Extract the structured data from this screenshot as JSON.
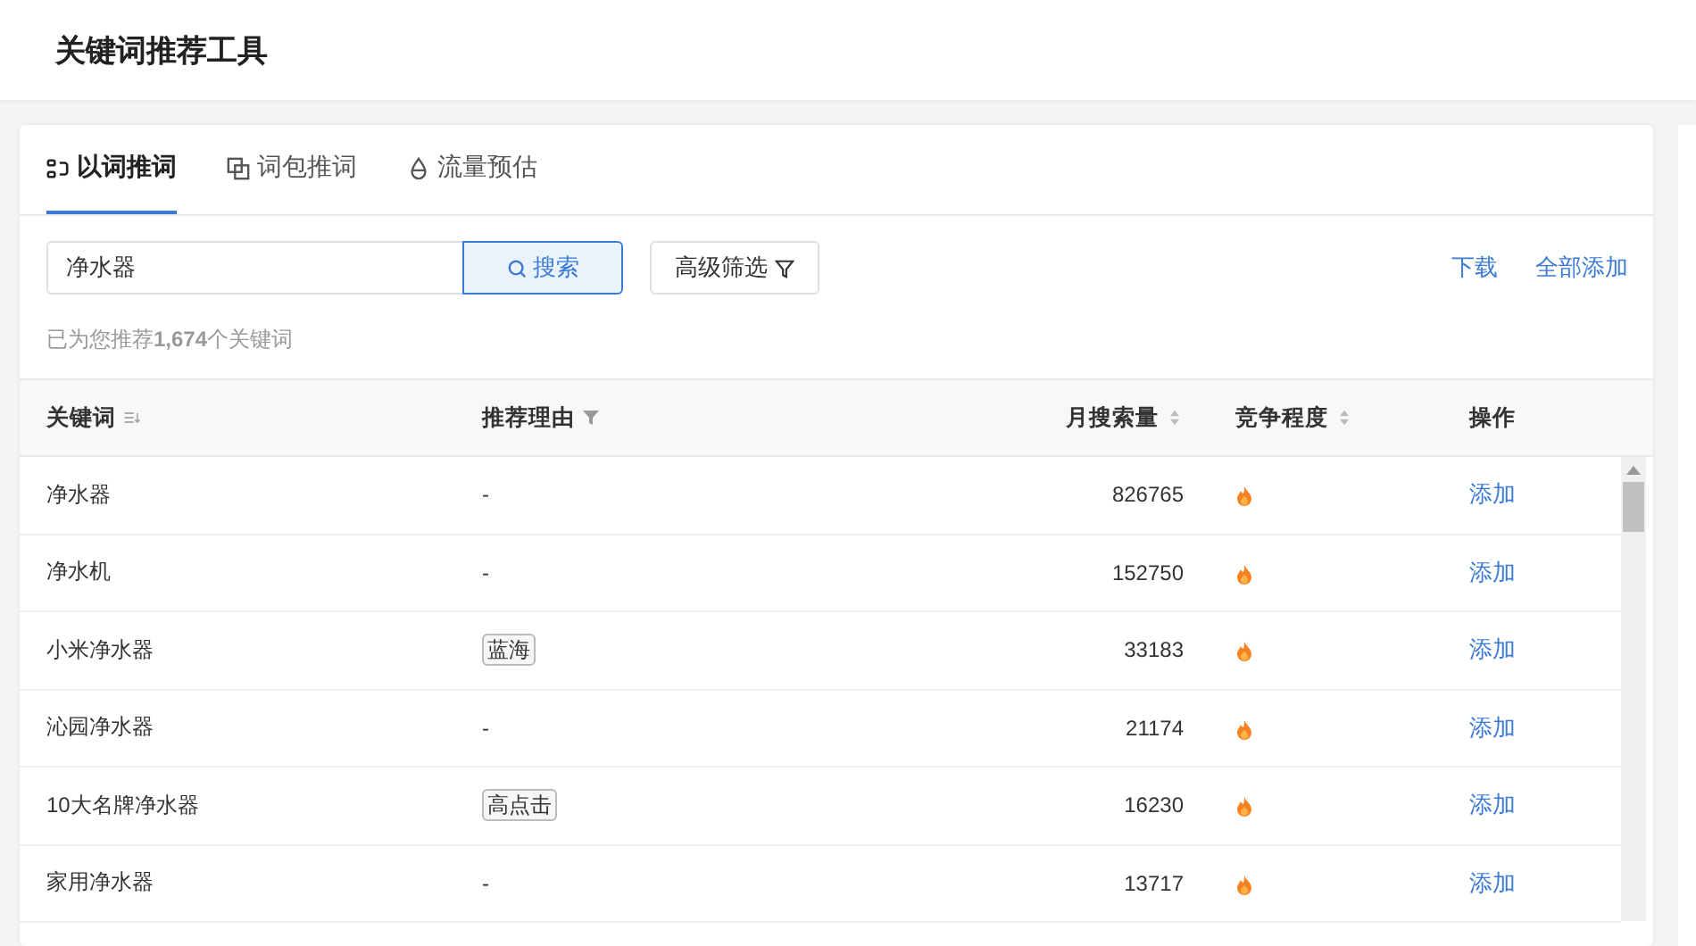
{
  "header": {
    "title": "关键词推荐工具"
  },
  "tabs": [
    {
      "label": "以词推词",
      "selected": true
    },
    {
      "label": "词包推词",
      "selected": false
    },
    {
      "label": "流量预估",
      "selected": false
    }
  ],
  "search": {
    "value": "净水器",
    "button": "搜索"
  },
  "filter_button": "高级筛选",
  "links": [
    "下载",
    "全部添加"
  ],
  "summary": "已为您推荐**1,674**个关键词",
  "table": {
    "columns": [
      "关键词",
      "推荐理由",
      "月搜索量",
      "竞争程度",
      "操作"
    ],
    "rows": [
      {
        "keyword": "净水器",
        "reason": {
          "kind": "plain",
          "text": "-"
        },
        "volume": "826765",
        "action": "添加"
      },
      {
        "keyword": "净水机",
        "reason": {
          "kind": "plain",
          "text": "-"
        },
        "volume": "152750",
        "action": "添加"
      },
      {
        "keyword": "小米净水器",
        "reason": {
          "kind": "tag",
          "text": "蓝海"
        },
        "volume": "33183",
        "action": "添加"
      },
      {
        "keyword": "沁园净水器",
        "reason": {
          "kind": "plain",
          "text": "-"
        },
        "volume": "21174",
        "action": "添加"
      },
      {
        "keyword": "10大名牌净水器",
        "reason": {
          "kind": "tag",
          "text": "高点击"
        },
        "volume": "16230",
        "action": "添加"
      },
      {
        "keyword": "家用净水器",
        "reason": {
          "kind": "plain",
          "text": "-"
        },
        "volume": "13717",
        "action": "添加"
      }
    ]
  }
}
